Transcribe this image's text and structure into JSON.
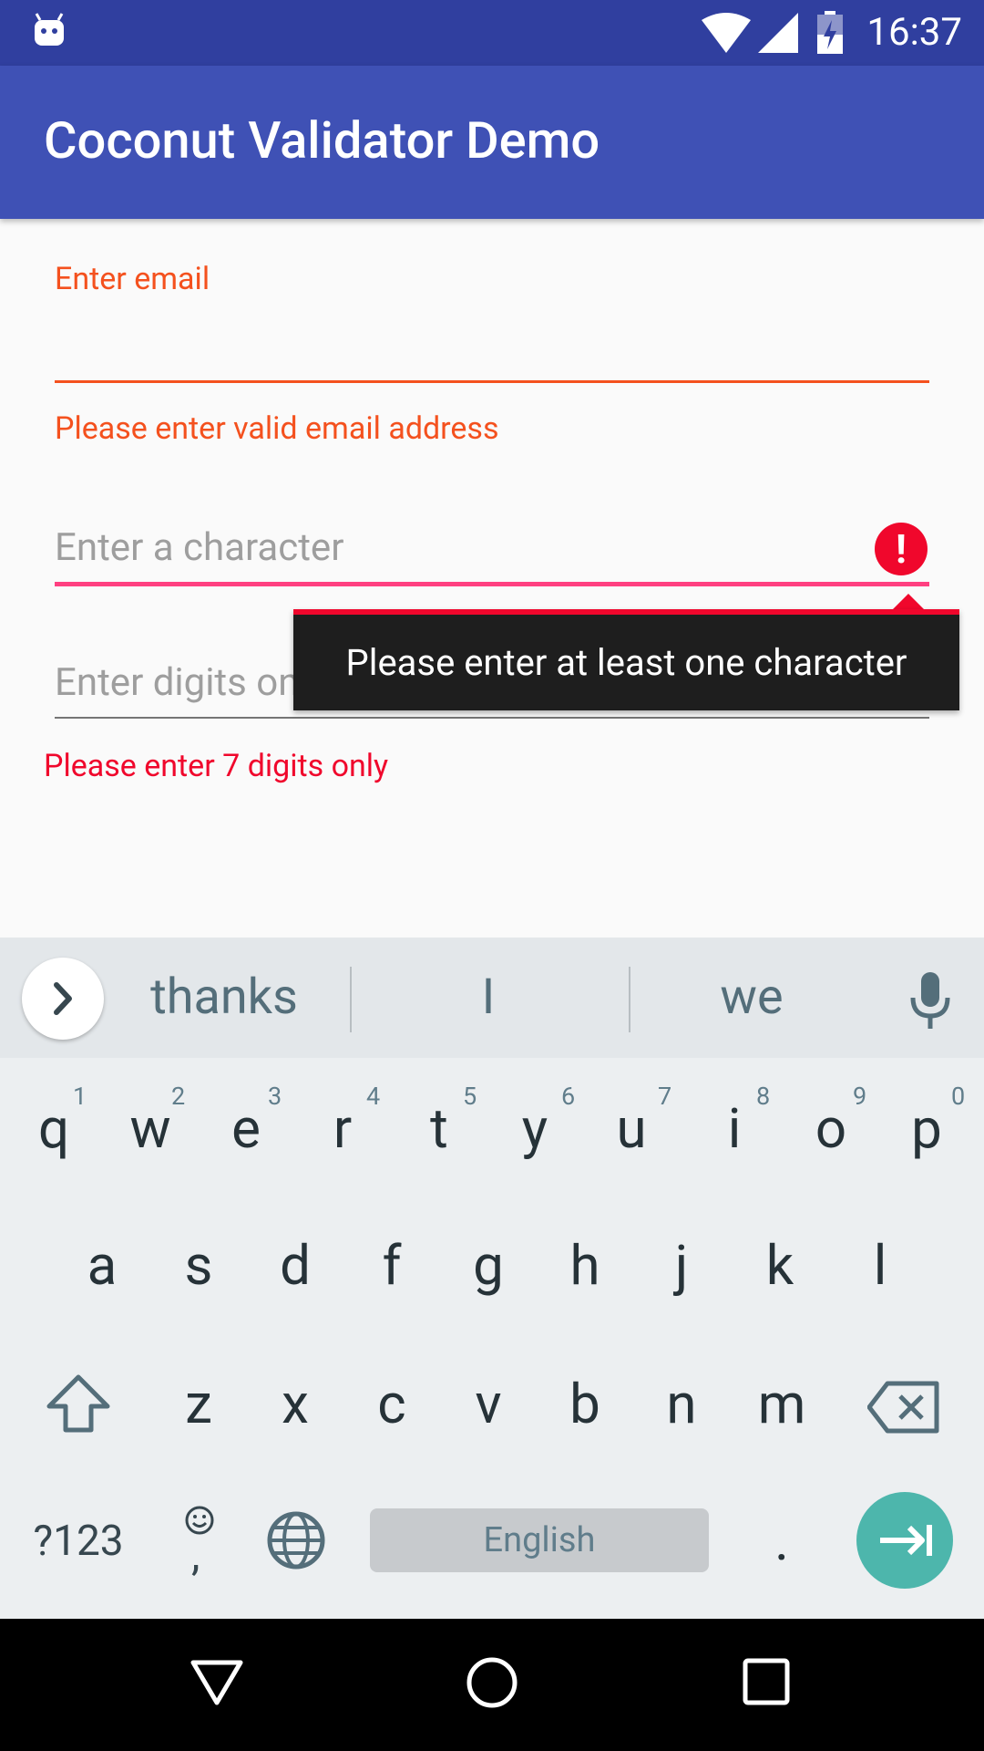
{
  "status_bar": {
    "time": "16:37"
  },
  "app_bar": {
    "title": "Coconut Validator Demo"
  },
  "form": {
    "email_label": "Enter email",
    "email_error": "Please enter valid email address",
    "character_hint": "Enter a character",
    "character_tooltip": "Please enter at least one character",
    "digits_hint": "Enter digits only",
    "digits_error": "Please enter 7 digits only"
  },
  "keyboard": {
    "suggestions": [
      "thanks",
      "I",
      "we"
    ],
    "row1": [
      "q",
      "w",
      "e",
      "r",
      "t",
      "y",
      "u",
      "i",
      "o",
      "p"
    ],
    "row1_hints": [
      "1",
      "2",
      "3",
      "4",
      "5",
      "6",
      "7",
      "8",
      "9",
      "0"
    ],
    "row2": [
      "a",
      "s",
      "d",
      "f",
      "g",
      "h",
      "j",
      "k",
      "l"
    ],
    "row3": [
      "z",
      "x",
      "c",
      "v",
      "b",
      "n",
      "m"
    ],
    "symbols_key": "?123",
    "comma_key": ",",
    "spacebar_label": "English",
    "period_key": "."
  }
}
